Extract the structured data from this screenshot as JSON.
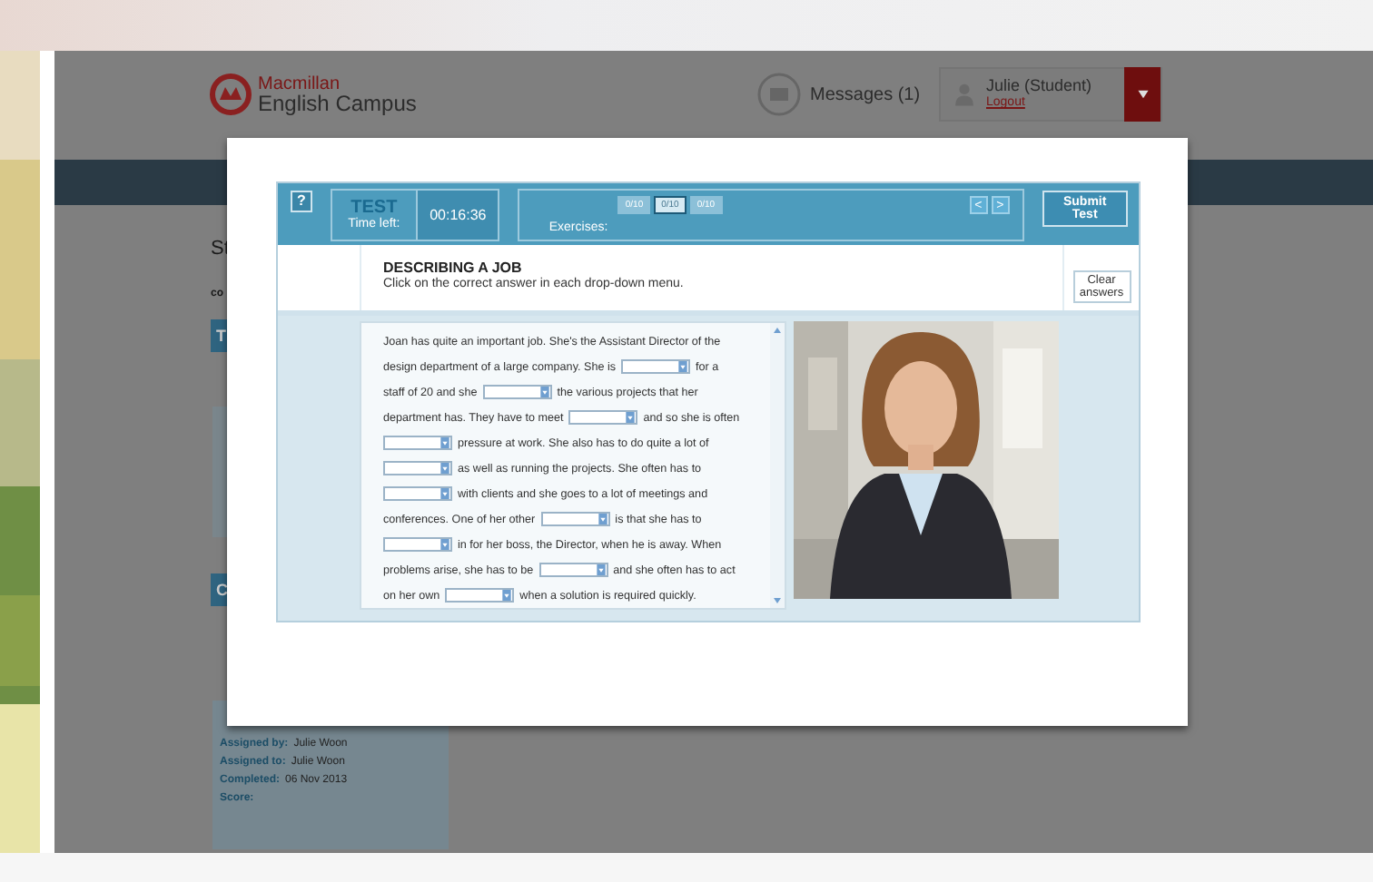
{
  "header": {
    "logo_top": "Macmillan",
    "logo_bottom": "English Campus",
    "messages": "Messages (1)",
    "user": "Julie (Student)",
    "logout": "Logout"
  },
  "background_page": {
    "heading": "St",
    "subheading": "co",
    "tabs": [
      "T",
      "C"
    ],
    "details": [
      {
        "label": "Assigned by:",
        "value": "Julie Woon"
      },
      {
        "label": "Assigned to:",
        "value": "Julie Woon"
      },
      {
        "label": "Completed:",
        "value": "06 Nov 2013"
      },
      {
        "label": "Score:"
      }
    ]
  },
  "test": {
    "help": "?",
    "title": "TEST",
    "time_label": "Time left:",
    "time": "00:16:36",
    "exercises_label": "Exercises:",
    "exercises": [
      {
        "label": "0/10",
        "selected": false
      },
      {
        "label": "0/10",
        "selected": true
      },
      {
        "label": "0/10",
        "selected": false
      }
    ],
    "prev": "<",
    "next": ">",
    "submit": "Submit Test"
  },
  "exercise": {
    "title": "DESCRIBING A JOB",
    "instruction": "Click on the correct answer in each drop-down menu.",
    "clear": "Clear answers",
    "lines": [
      [
        {
          "kind": "text",
          "text": "Joan has quite an important job. She's the Assistant Director of the"
        }
      ],
      [
        {
          "kind": "text",
          "text": "design department of a large company. She is"
        },
        {
          "kind": "select"
        },
        {
          "kind": "text",
          "text": "for a"
        }
      ],
      [
        {
          "kind": "text",
          "text": "staff of 20 and she"
        },
        {
          "kind": "select"
        },
        {
          "kind": "text",
          "text": "the various projects that her"
        }
      ],
      [
        {
          "kind": "text",
          "text": "department has. They have to meet"
        },
        {
          "kind": "select"
        },
        {
          "kind": "text",
          "text": "and so she is often"
        }
      ],
      [
        {
          "kind": "select"
        },
        {
          "kind": "text",
          "text": "pressure at work. She also has to do quite a lot of"
        }
      ],
      [
        {
          "kind": "select"
        },
        {
          "kind": "text",
          "text": "as well as running the projects. She often has to"
        }
      ],
      [
        {
          "kind": "select"
        },
        {
          "kind": "text",
          "text": "with clients and she goes to a lot of meetings and"
        }
      ],
      [
        {
          "kind": "text",
          "text": "conferences. One of her other"
        },
        {
          "kind": "select"
        },
        {
          "kind": "text",
          "text": "is that she has to"
        }
      ],
      [
        {
          "kind": "select"
        },
        {
          "kind": "text",
          "text": "in for her boss, the Director, when he is away. When"
        }
      ],
      [
        {
          "kind": "text",
          "text": "problems arise, she has to be"
        },
        {
          "kind": "select"
        },
        {
          "kind": "text",
          "text": "and she often has to act"
        }
      ],
      [
        {
          "kind": "text",
          "text": "on her own"
        },
        {
          "kind": "select"
        },
        {
          "kind": "text",
          "text": "when a solution is required quickly."
        }
      ]
    ]
  }
}
